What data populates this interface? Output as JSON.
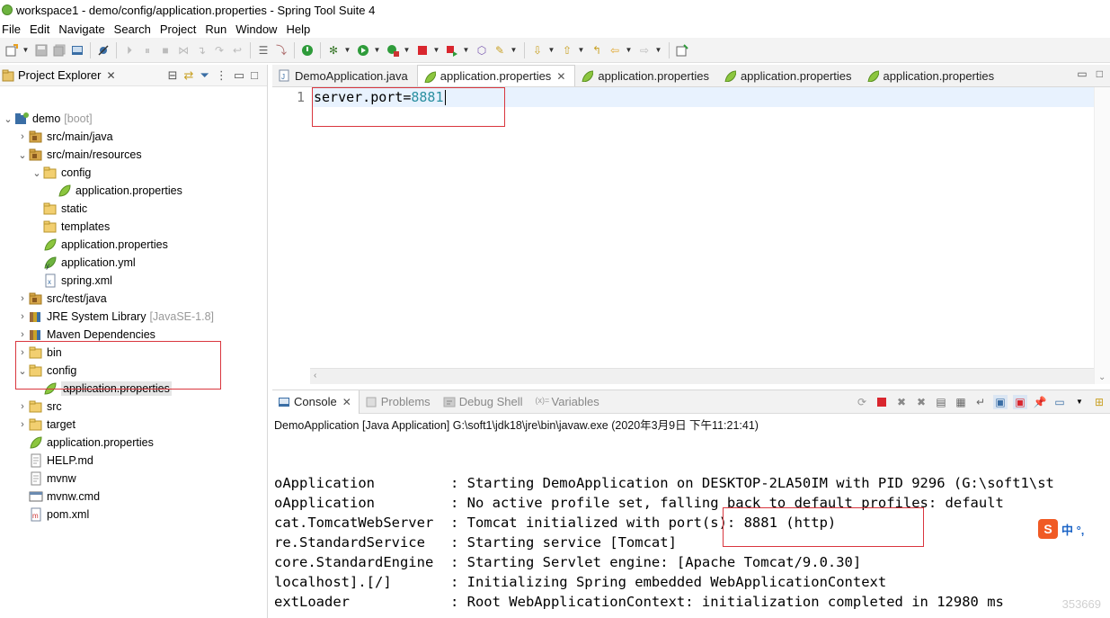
{
  "window": {
    "title": "workspace1 - demo/config/application.properties - Spring Tool Suite 4"
  },
  "menu": [
    "File",
    "Edit",
    "Navigate",
    "Search",
    "Project",
    "Run",
    "Window",
    "Help"
  ],
  "explorer": {
    "title": "Project Explorer",
    "tree": [
      {
        "label": "demo",
        "deco": "[boot]",
        "icon": "project-icon",
        "twisty": "v"
      },
      {
        "label": "src/main/java",
        "icon": "source-folder-icon",
        "twisty": ">"
      },
      {
        "label": "src/main/resources",
        "icon": "source-folder-icon",
        "twisty": "v"
      },
      {
        "label": "config",
        "icon": "folder-icon",
        "twisty": "v"
      },
      {
        "label": "application.properties",
        "icon": "spring-leaf-icon",
        "twisty": ""
      },
      {
        "label": "static",
        "icon": "folder-icon",
        "twisty": ""
      },
      {
        "label": "templates",
        "icon": "folder-icon",
        "twisty": ""
      },
      {
        "label": "application.properties",
        "icon": "spring-leaf-icon",
        "twisty": ""
      },
      {
        "label": "application.yml",
        "icon": "spring-yml-icon",
        "twisty": ""
      },
      {
        "label": "spring.xml",
        "icon": "xml-file-icon",
        "twisty": ""
      },
      {
        "label": "src/test/java",
        "icon": "source-folder-icon",
        "twisty": ">"
      },
      {
        "label": "JRE System Library",
        "deco": "[JavaSE-1.8]",
        "icon": "library-icon",
        "twisty": ">"
      },
      {
        "label": "Maven Dependencies",
        "icon": "library-icon",
        "twisty": ">"
      },
      {
        "label": "bin",
        "icon": "folder-icon",
        "twisty": ">"
      },
      {
        "label": "config",
        "icon": "folder-icon",
        "twisty": "v"
      },
      {
        "label": "application.properties",
        "icon": "spring-leaf-icon",
        "twisty": ""
      },
      {
        "label": "src",
        "icon": "folder-icon",
        "twisty": ">"
      },
      {
        "label": "target",
        "icon": "folder-icon",
        "twisty": ">"
      },
      {
        "label": "application.properties",
        "icon": "spring-leaf-icon",
        "twisty": ""
      },
      {
        "label": "HELP.md",
        "icon": "file-icon",
        "twisty": ""
      },
      {
        "label": "mvnw",
        "icon": "file-icon",
        "twisty": ""
      },
      {
        "label": "mvnw.cmd",
        "icon": "cmd-file-icon",
        "twisty": ""
      },
      {
        "label": "pom.xml",
        "icon": "maven-file-icon",
        "twisty": ""
      }
    ]
  },
  "editor": {
    "tabs": [
      {
        "label": "DemoApplication.java",
        "icon": "java-file-icon"
      },
      {
        "label": "application.properties",
        "icon": "spring-leaf-icon",
        "active": true
      },
      {
        "label": "application.properties",
        "icon": "spring-leaf-icon"
      },
      {
        "label": "application.properties",
        "icon": "spring-leaf-icon"
      },
      {
        "label": "application.properties",
        "icon": "spring-leaf-icon"
      }
    ],
    "line_number": "1",
    "code_key": "server.port=",
    "code_value": "8881"
  },
  "console": {
    "tabs": [
      {
        "label": "Console",
        "active": true
      },
      {
        "label": "Problems"
      },
      {
        "label": "Debug Shell"
      },
      {
        "label": "Variables"
      }
    ],
    "description": "DemoApplication [Java Application] G:\\soft1\\jdk18\\jre\\bin\\javaw.exe (2020年3月9日 下午11:21:41)",
    "lines": [
      "oApplication         : Starting DemoApplication on DESKTOP-2LA50IM with PID 9296 (G:\\soft1\\st",
      "oApplication         : No active profile set, falling back to default profiles: default",
      "cat.TomcatWebServer  : Tomcat initialized with port(s): 8881 (http)",
      "re.StandardService   : Starting service [Tomcat]",
      "core.StandardEngine  : Starting Servlet engine: [Apache Tomcat/9.0.30]",
      "localhost].[/]       : Initializing Spring embedded WebApplicationContext",
      "extLoader            : Root WebApplicationContext: initialization completed in 12980 ms"
    ]
  },
  "ime": {
    "text": "中 °,"
  },
  "watermark": "353669",
  "colors": {
    "highlight_box": "#d9363e",
    "property_value": "#2a8fa0",
    "current_line": "#e8f2fe"
  }
}
